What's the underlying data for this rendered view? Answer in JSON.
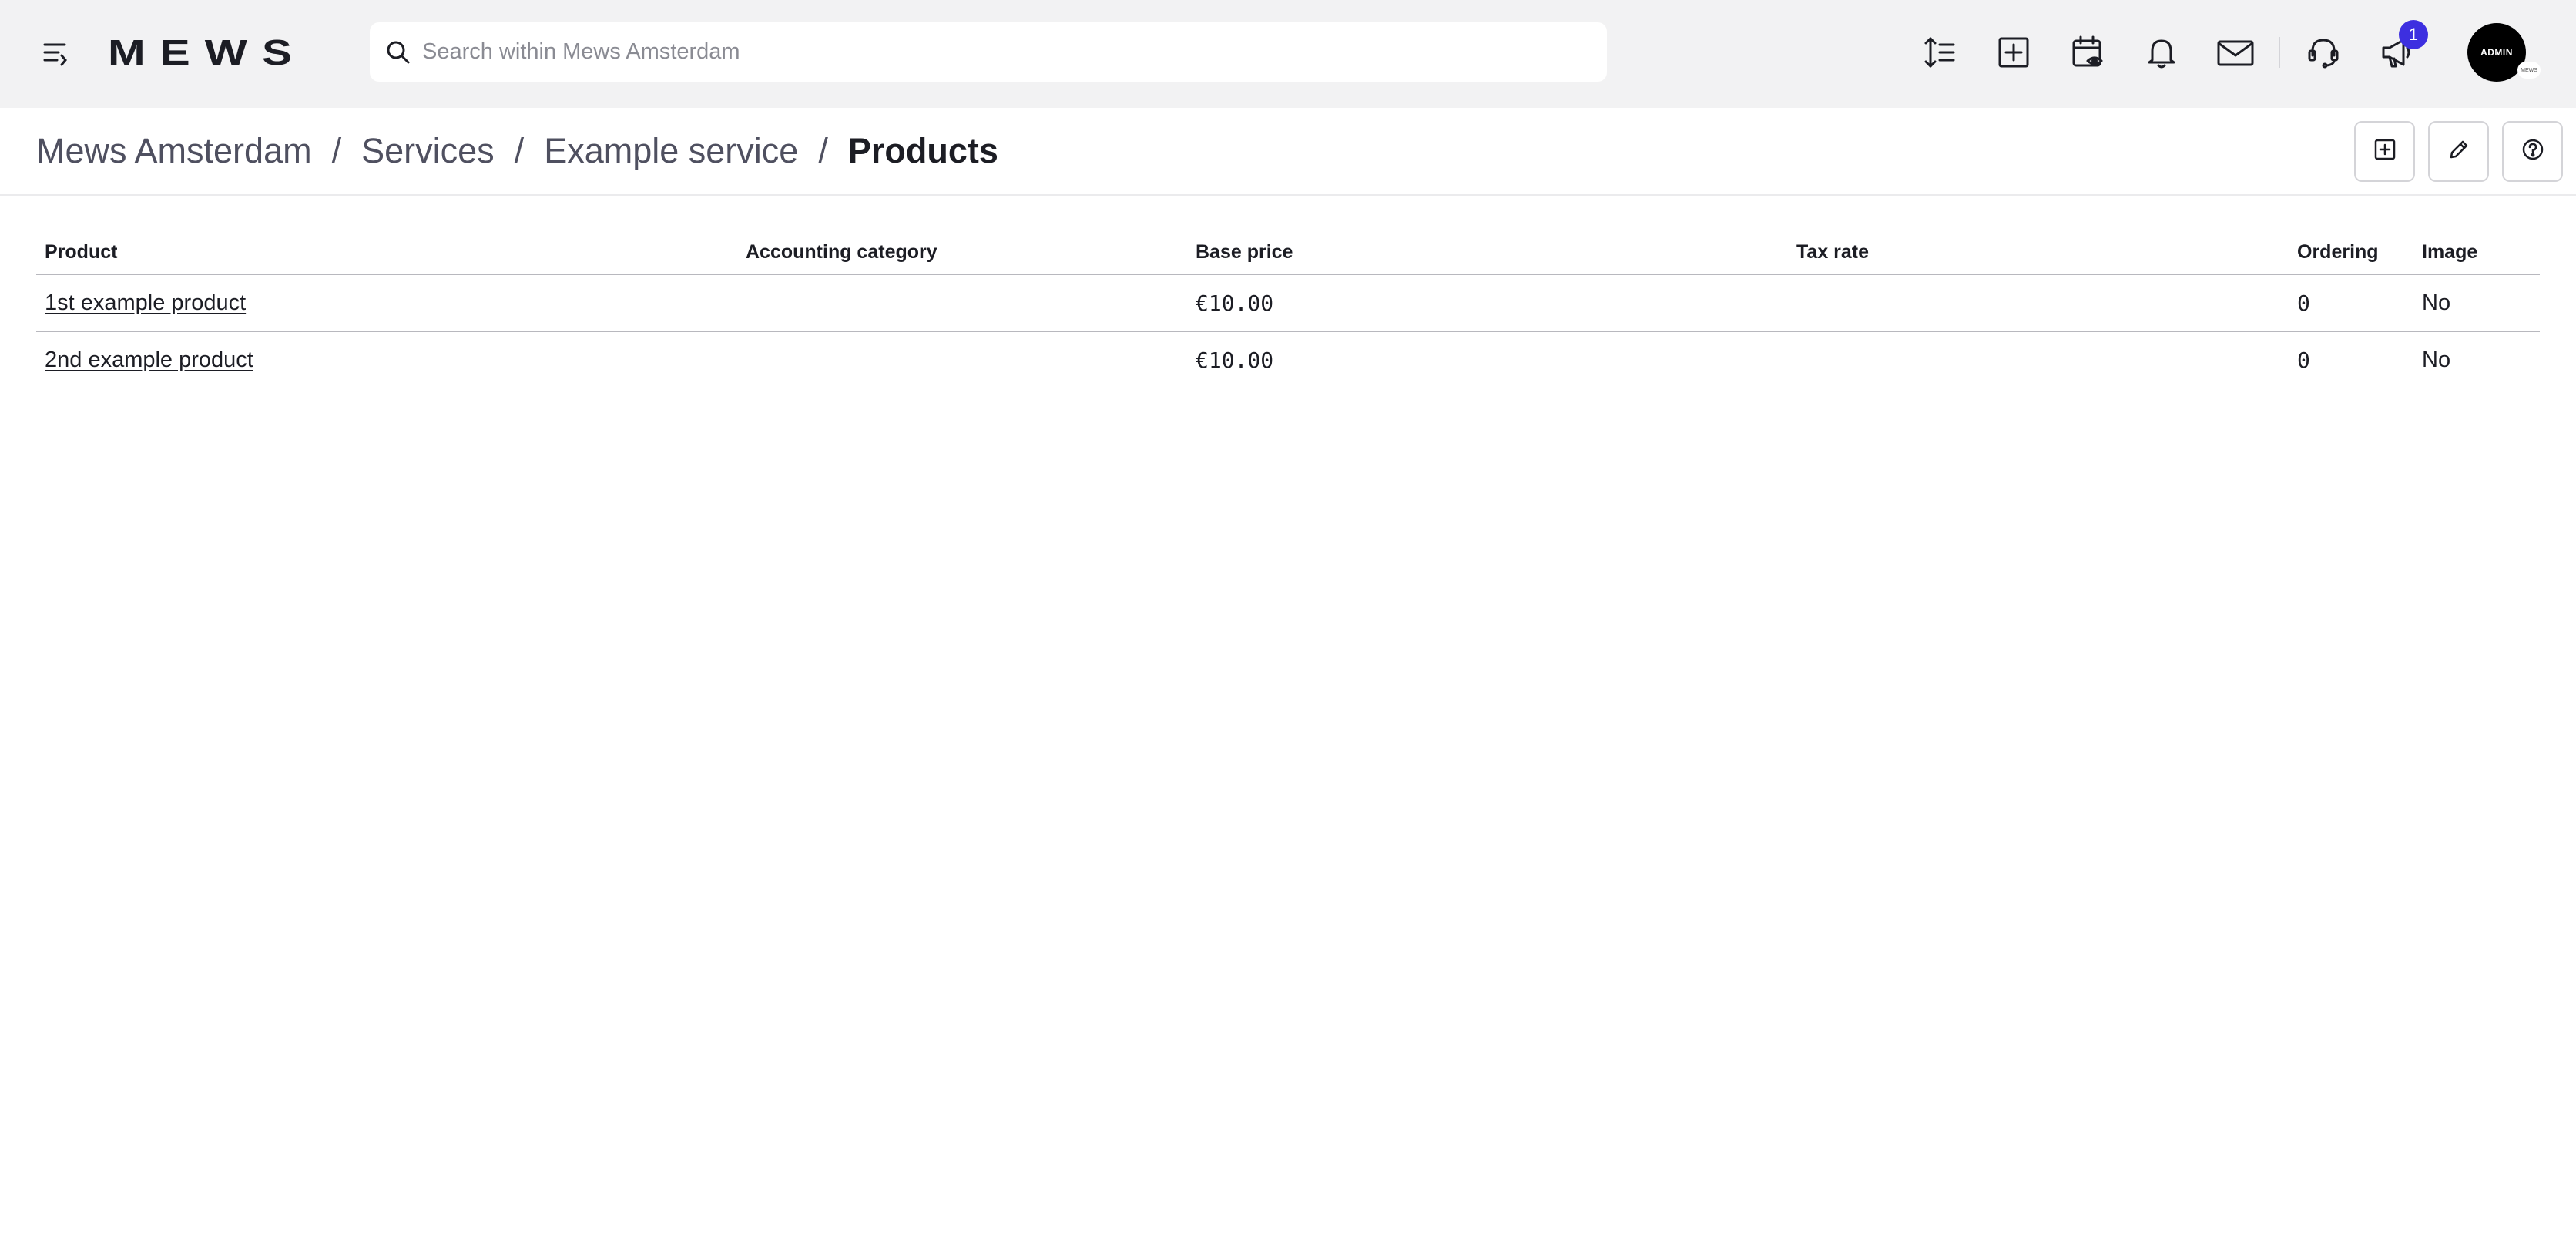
{
  "topbar": {
    "brand": "MEWS",
    "search_placeholder": "Search within Mews Amsterdam",
    "notification_badge": "1",
    "avatar_label": "ADMIN",
    "avatar_sub_label": "MEWS",
    "icons": [
      "menu-icon",
      "line-height-icon",
      "add-square-icon",
      "calendar-eye-icon",
      "bell-icon",
      "mail-icon",
      "headset-icon",
      "megaphone-icon"
    ]
  },
  "breadcrumb": {
    "items": [
      "Mews Amsterdam",
      "Services",
      "Example service"
    ],
    "separator": "/",
    "current": "Products"
  },
  "header_actions": [
    "add-icon",
    "edit-icon",
    "help-icon"
  ],
  "table": {
    "columns": [
      "Product",
      "Accounting category",
      "Base price",
      "Tax rate",
      "Ordering",
      "Image"
    ],
    "rows": [
      {
        "product": "1st example product",
        "accounting_category": "",
        "base_price": "€10.00",
        "tax_rate": "",
        "ordering": "0",
        "image": "No"
      },
      {
        "product": "2nd example product",
        "accounting_category": "",
        "base_price": "€10.00",
        "tax_rate": "",
        "ordering": "0",
        "image": "No"
      }
    ]
  },
  "colors": {
    "topbar_bg": "#f2f2f3",
    "badge": "#3d2fe0",
    "text": "#1c1d24",
    "breadcrumb_link": "#4f5060"
  }
}
